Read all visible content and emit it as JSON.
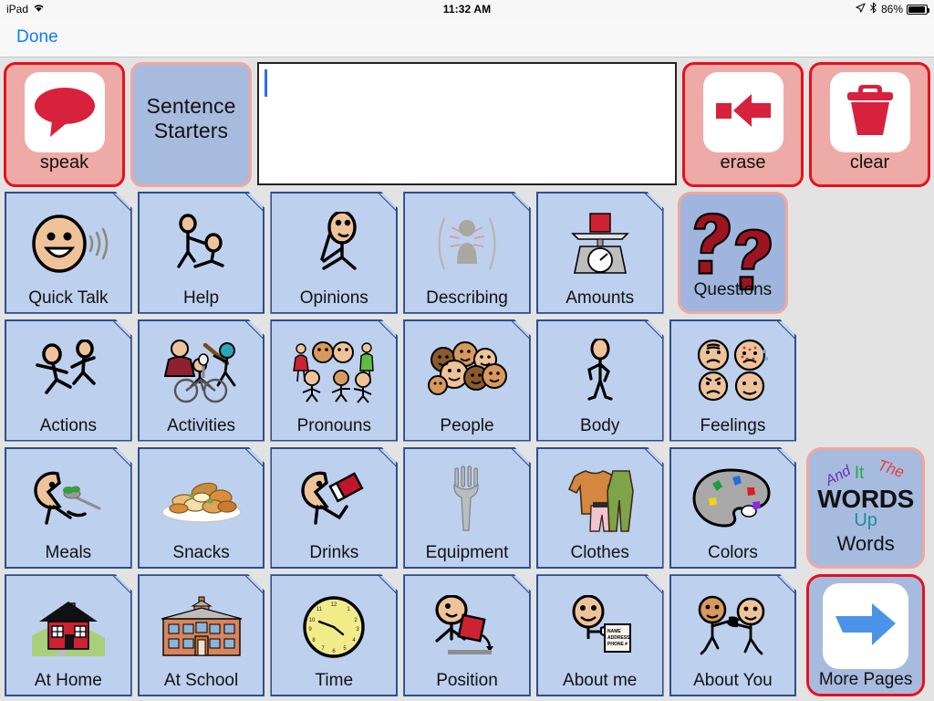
{
  "status_bar": {
    "device": "iPad",
    "wifi_icon": "wifi-icon",
    "time": "11:32 AM",
    "location_icon": "location-arrow-icon",
    "bluetooth_icon": "bluetooth-icon",
    "battery_percent": "86%",
    "battery_icon": "battery-icon"
  },
  "nav": {
    "done_label": "Done"
  },
  "toolbar": {
    "speak": {
      "label": "speak",
      "icon": "speech-bubble-icon"
    },
    "sentence_starters": {
      "label": "Sentence\nStarters",
      "line1": "Sentence",
      "line2": "Starters"
    },
    "message_bar": {
      "value": "",
      "placeholder": ""
    },
    "erase": {
      "label": "erase",
      "icon": "backspace-arrow-icon"
    },
    "clear": {
      "label": "clear",
      "icon": "trash-can-icon"
    }
  },
  "grid": {
    "rows": 4,
    "columns": 7,
    "cells": [
      {
        "label": "Quick Talk",
        "icon": "talking-face-icon",
        "style": "standard"
      },
      {
        "label": "Help",
        "icon": "helping-hand-icon",
        "style": "standard"
      },
      {
        "label": "Opinions",
        "icon": "thinking-person-icon",
        "style": "standard"
      },
      {
        "label": "Describing",
        "icon": "person-aura-icon",
        "style": "standard"
      },
      {
        "label": "Amounts",
        "icon": "weighing-scale-icon",
        "style": "standard"
      },
      {
        "label": "Questions",
        "icon": "question-marks-icon",
        "style": "selected"
      },
      {
        "label": "",
        "icon": "",
        "style": "empty"
      },
      {
        "label": "Actions",
        "icon": "running-people-icon",
        "style": "standard"
      },
      {
        "label": "Activities",
        "icon": "sports-activities-icon",
        "style": "standard"
      },
      {
        "label": "Pronouns",
        "icon": "group-pronouns-icon",
        "style": "standard"
      },
      {
        "label": "People",
        "icon": "crowd-faces-icon",
        "style": "standard"
      },
      {
        "label": "Body",
        "icon": "standing-person-icon",
        "style": "standard"
      },
      {
        "label": "Feelings",
        "icon": "emotion-faces-icon",
        "style": "standard"
      },
      {
        "label": "",
        "icon": "",
        "style": "empty"
      },
      {
        "label": "Meals",
        "icon": "eating-person-icon",
        "style": "standard"
      },
      {
        "label": "Snacks",
        "icon": "plate-of-snacks-icon",
        "style": "standard"
      },
      {
        "label": "Drinks",
        "icon": "drinking-person-icon",
        "style": "standard"
      },
      {
        "label": "Equipment",
        "icon": "fork-icon",
        "style": "standard"
      },
      {
        "label": "Clothes",
        "icon": "clothing-icon",
        "style": "standard"
      },
      {
        "label": "Colors",
        "icon": "paint-palette-icon",
        "style": "standard"
      },
      {
        "label": "Words",
        "icon": "word-art-icon",
        "style": "words"
      },
      {
        "label": "At Home",
        "icon": "house-icon",
        "style": "standard"
      },
      {
        "label": "At School",
        "icon": "school-building-icon",
        "style": "standard"
      },
      {
        "label": "Time",
        "icon": "clock-icon",
        "style": "standard"
      },
      {
        "label": "Position",
        "icon": "placing-block-icon",
        "style": "standard"
      },
      {
        "label": "About me",
        "icon": "person-id-card-icon",
        "style": "standard"
      },
      {
        "label": "About You",
        "icon": "two-people-pointing-icon",
        "style": "standard"
      },
      {
        "label": "More Pages",
        "icon": "right-arrow-icon",
        "style": "morepages"
      }
    ]
  },
  "word_art": {
    "and": "And",
    "it": "It",
    "the": "The",
    "words_big": "WORDS",
    "up": "Up",
    "words": "Words"
  },
  "colors": {
    "tile_fill": "#bdd0ee",
    "tile_border": "#2b4f8e",
    "selected_fill": "#9fb5de",
    "selected_border": "#f2a79d",
    "red_border": "#e8101c",
    "red_fill": "#eeaaa6",
    "accent_blue": "#0a7cff",
    "page_background": "#e3e3e3"
  }
}
